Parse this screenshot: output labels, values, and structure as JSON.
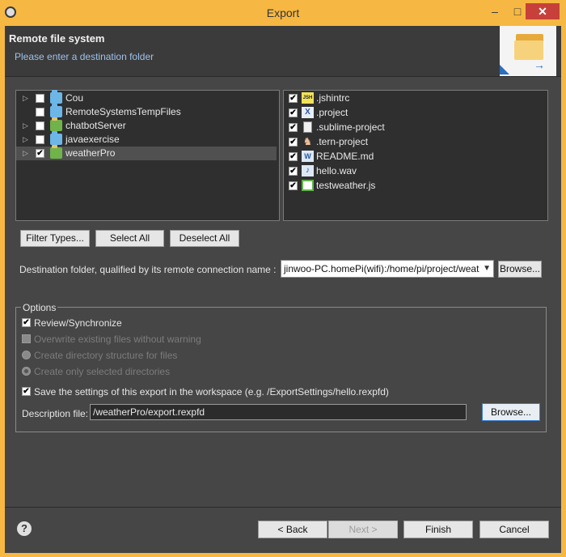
{
  "window": {
    "title": "Export",
    "min_glyph": "–",
    "max_glyph": "□",
    "close_glyph": "✕"
  },
  "header": {
    "title": "Remote file system",
    "subtitle": "Please enter a destination folder"
  },
  "tree": {
    "items": [
      {
        "label": "Cou",
        "checked": false,
        "expander": true,
        "icon": "folder-icon"
      },
      {
        "label": "RemoteSystemsTempFiles",
        "checked": false,
        "expander": false,
        "icon": "folder-icon"
      },
      {
        "label": "chatbotServer",
        "checked": false,
        "expander": true,
        "icon": "project-icon"
      },
      {
        "label": "javaexercise",
        "checked": false,
        "expander": true,
        "icon": "folder-icon"
      },
      {
        "label": "weatherPro",
        "checked": true,
        "expander": true,
        "icon": "project-icon",
        "selected": true
      }
    ]
  },
  "files": {
    "items": [
      {
        "label": ".jshintrc",
        "checked": true,
        "icon": "jshint-file-icon"
      },
      {
        "label": ".project",
        "checked": true,
        "icon": "xml-file-icon"
      },
      {
        "label": ".sublime-project",
        "checked": true,
        "icon": "text-file-icon"
      },
      {
        "label": ".tern-project",
        "checked": true,
        "icon": "tern-file-icon"
      },
      {
        "label": "README.md",
        "checked": true,
        "icon": "markdown-file-icon"
      },
      {
        "label": "hello.wav",
        "checked": true,
        "icon": "audio-file-icon"
      },
      {
        "label": "testweather.js",
        "checked": true,
        "icon": "js-file-icon"
      }
    ]
  },
  "buttons": {
    "filter_types": "Filter Types...",
    "select_all": "Select All",
    "deselect_all": "Deselect All",
    "browse_dest": "Browse...",
    "browse_desc": "Browse...",
    "back": "< Back",
    "next": "Next >",
    "finish": "Finish",
    "cancel": "Cancel"
  },
  "destination": {
    "label": "Destination folder, qualified by its remote connection name :",
    "value": "jinwoo-PC.homePi(wifi):/home/pi/project/weat"
  },
  "options": {
    "title": "Options",
    "review_sync": {
      "label": "Review/Synchronize",
      "checked": true
    },
    "overwrite": {
      "label": "Overwrite existing files without warning",
      "checked": false
    },
    "create_structure": {
      "label": "Create directory structure for files",
      "selected": false
    },
    "create_selected": {
      "label": "Create only selected directories",
      "selected": true
    },
    "save_settings": {
      "label": "Save the settings of this export in the workspace (e.g. /ExportSettings/hello.rexpfd)",
      "checked": true
    },
    "description_label": "Description file:",
    "description_value": "/weatherPro/export.rexpfd"
  },
  "help_glyph": "?"
}
